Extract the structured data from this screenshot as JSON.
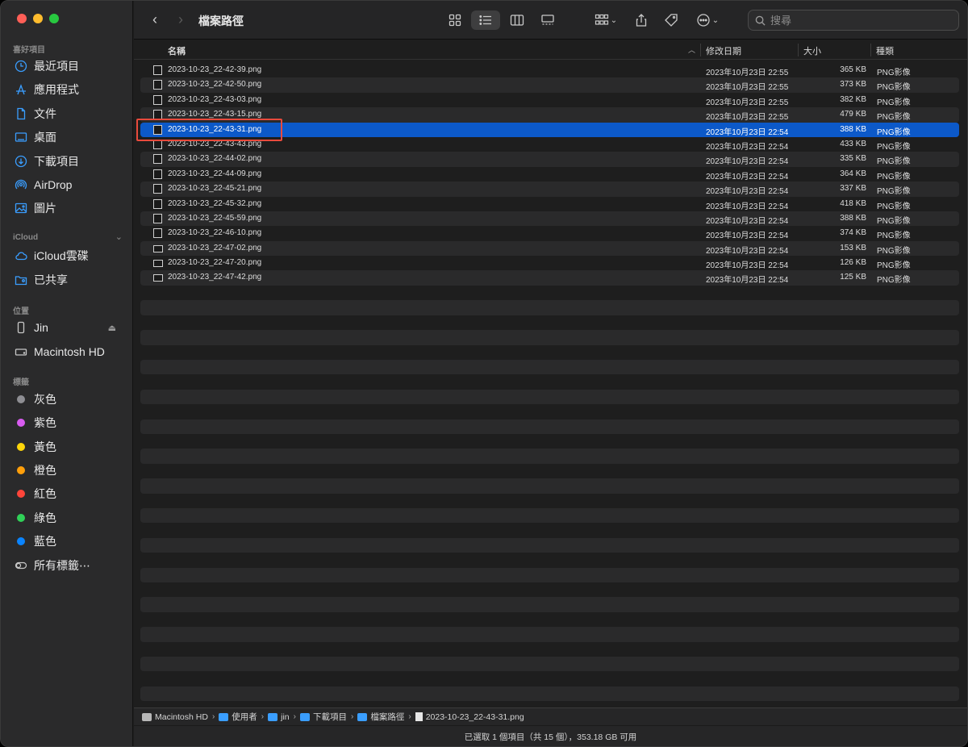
{
  "window": {
    "title": "檔案路徑"
  },
  "sidebar": {
    "favorites_label": "喜好項目",
    "favorites": [
      {
        "label": "最近項目",
        "icon": "clock-icon"
      },
      {
        "label": "應用程式",
        "icon": "apps-icon"
      },
      {
        "label": "文件",
        "icon": "document-icon"
      },
      {
        "label": "桌面",
        "icon": "desktop-icon"
      },
      {
        "label": "下載項目",
        "icon": "download-icon"
      },
      {
        "label": "AirDrop",
        "icon": "airdrop-icon"
      },
      {
        "label": "圖片",
        "icon": "photo-icon"
      }
    ],
    "icloud_label": "iCloud",
    "icloud": [
      {
        "label": "iCloud雲碟",
        "icon": "cloud-icon"
      },
      {
        "label": "已共享",
        "icon": "shared-folder-icon"
      }
    ],
    "locations_label": "位置",
    "locations": [
      {
        "label": "Jin",
        "icon": "phone-icon"
      },
      {
        "label": "Macintosh HD",
        "icon": "disk-icon"
      }
    ],
    "tags_label": "標籤",
    "tags": [
      {
        "label": "灰色",
        "color": "#8e8e93"
      },
      {
        "label": "紫色",
        "color": "#d85cf0"
      },
      {
        "label": "黃色",
        "color": "#ffd60a"
      },
      {
        "label": "橙色",
        "color": "#ff9f0a"
      },
      {
        "label": "紅色",
        "color": "#ff453a"
      },
      {
        "label": "綠色",
        "color": "#30d158"
      },
      {
        "label": "藍色",
        "color": "#0a84ff"
      }
    ],
    "all_tags": "所有標籤⋯"
  },
  "search": {
    "placeholder": "搜尋"
  },
  "columns": {
    "name": "名稱",
    "date": "修改日期",
    "size": "大小",
    "kind": "種類"
  },
  "files": [
    {
      "name": "2023-10-23_22-42-39.png",
      "date": "2023年10月23日 22:55",
      "size": "365 KB",
      "kind": "PNG影像"
    },
    {
      "name": "2023-10-23_22-42-50.png",
      "date": "2023年10月23日 22:55",
      "size": "373 KB",
      "kind": "PNG影像"
    },
    {
      "name": "2023-10-23_22-43-03.png",
      "date": "2023年10月23日 22:55",
      "size": "382 KB",
      "kind": "PNG影像"
    },
    {
      "name": "2023-10-23_22-43-15.png",
      "date": "2023年10月23日 22:55",
      "size": "479 KB",
      "kind": "PNG影像"
    },
    {
      "name": "2023-10-23_22-43-31.png",
      "date": "2023年10月23日 22:54",
      "size": "388 KB",
      "kind": "PNG影像",
      "selected": true
    },
    {
      "name": "2023-10-23_22-43-43.png",
      "date": "2023年10月23日 22:54",
      "size": "433 KB",
      "kind": "PNG影像"
    },
    {
      "name": "2023-10-23_22-44-02.png",
      "date": "2023年10月23日 22:54",
      "size": "335 KB",
      "kind": "PNG影像"
    },
    {
      "name": "2023-10-23_22-44-09.png",
      "date": "2023年10月23日 22:54",
      "size": "364 KB",
      "kind": "PNG影像"
    },
    {
      "name": "2023-10-23_22-45-21.png",
      "date": "2023年10月23日 22:54",
      "size": "337 KB",
      "kind": "PNG影像"
    },
    {
      "name": "2023-10-23_22-45-32.png",
      "date": "2023年10月23日 22:54",
      "size": "418 KB",
      "kind": "PNG影像"
    },
    {
      "name": "2023-10-23_22-45-59.png",
      "date": "2023年10月23日 22:54",
      "size": "388 KB",
      "kind": "PNG影像"
    },
    {
      "name": "2023-10-23_22-46-10.png",
      "date": "2023年10月23日 22:54",
      "size": "374 KB",
      "kind": "PNG影像"
    },
    {
      "name": "2023-10-23_22-47-02.png",
      "date": "2023年10月23日 22:54",
      "size": "153 KB",
      "kind": "PNG影像"
    },
    {
      "name": "2023-10-23_22-47-20.png",
      "date": "2023年10月23日 22:54",
      "size": "126 KB",
      "kind": "PNG影像"
    },
    {
      "name": "2023-10-23_22-47-42.png",
      "date": "2023年10月23日 22:54",
      "size": "125 KB",
      "kind": "PNG影像"
    }
  ],
  "pathbar": [
    "Macintosh HD",
    "使用者",
    "jin",
    "下載項目",
    "檔案路徑",
    "2023-10-23_22-43-31.png"
  ],
  "status": "已選取 1 個項目（共 15 個），353.18 GB 可用"
}
